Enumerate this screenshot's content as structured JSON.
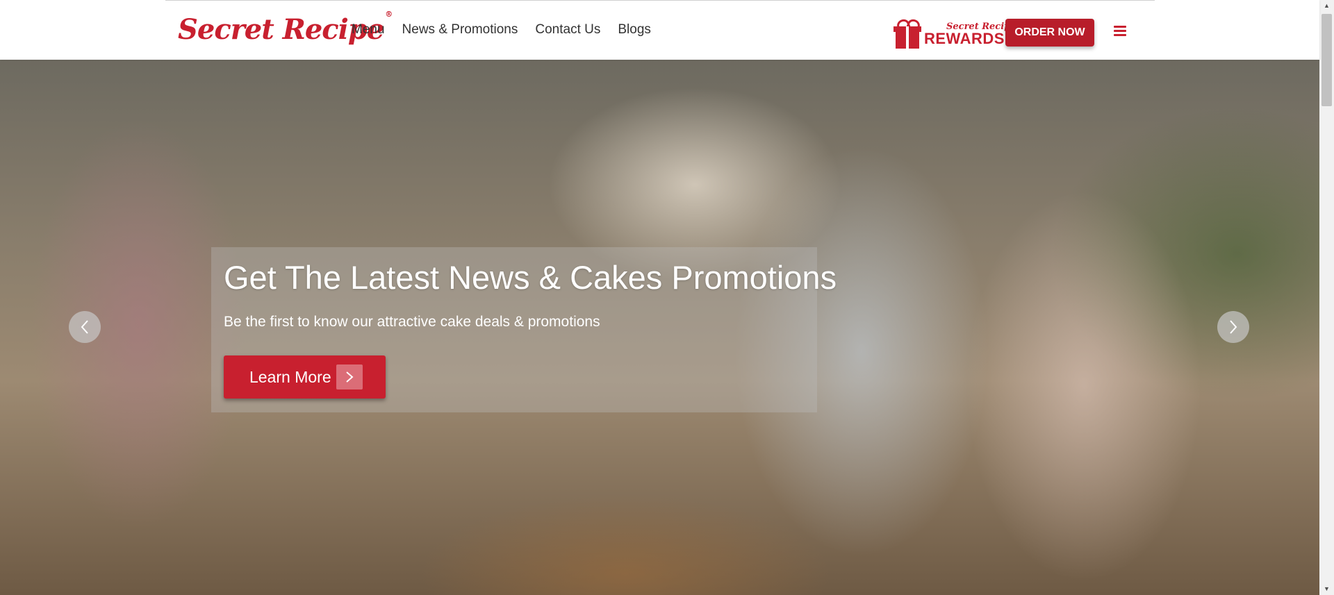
{
  "header": {
    "logo_text": "Secret Recipe",
    "logo_mark": "®",
    "nav": [
      {
        "label": "Menu"
      },
      {
        "label": "News & Promotions"
      },
      {
        "label": "Contact Us"
      },
      {
        "label": "Blogs"
      }
    ],
    "rewards_brand": "Secret Recipe",
    "rewards_label": "REWARDS",
    "order_button": "ORDER NOW",
    "menu_icon": "hamburger-icon"
  },
  "hero": {
    "title": "Get The Latest News & Cakes Promotions",
    "subtitle": "Be the first to know our attractive cake deals & promotions",
    "cta_label": "Learn More",
    "cta_icon": "chevron-right-icon",
    "prev_icon": "chevron-left-icon",
    "next_icon": "chevron-right-icon"
  },
  "colors": {
    "brand_red": "#c8202f",
    "button_red": "#b81d2a"
  }
}
